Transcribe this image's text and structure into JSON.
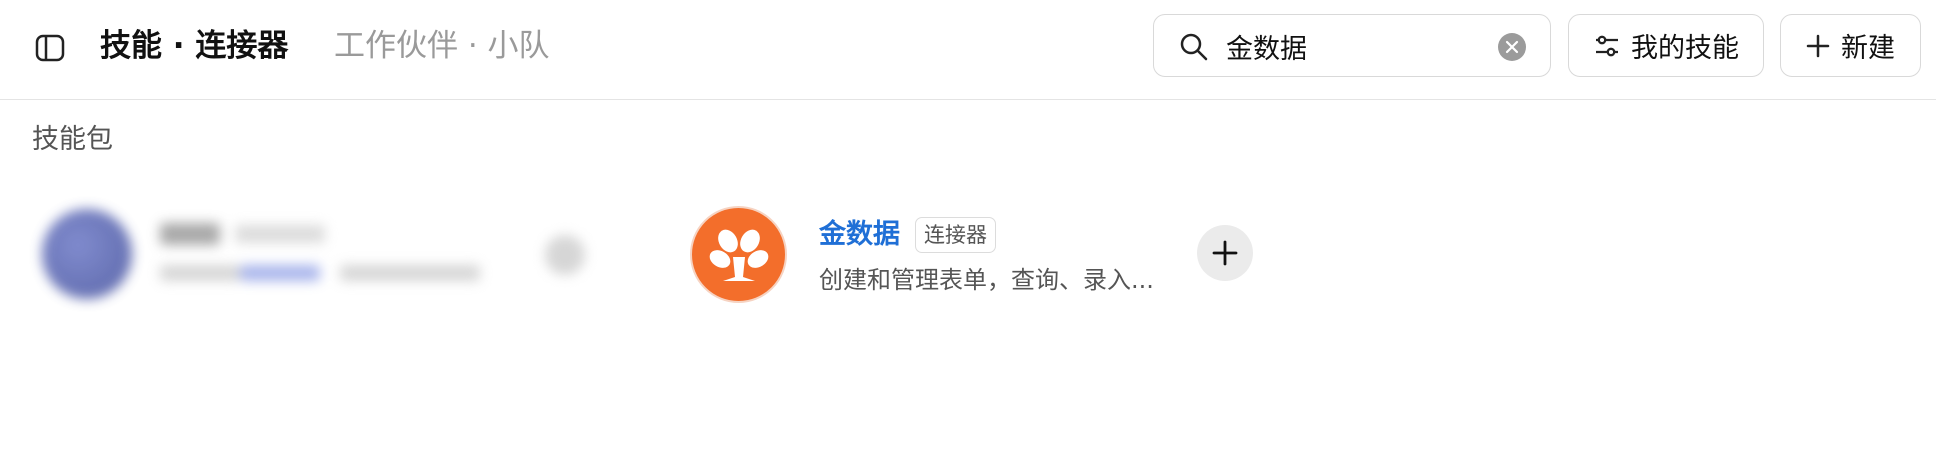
{
  "header": {
    "tabs": [
      {
        "label": "技能 · 连接器",
        "active": true
      },
      {
        "label": "工作伙伴 · 小队",
        "active": false
      }
    ],
    "search": {
      "value": "金数据",
      "placeholder": ""
    },
    "my_skills_label": "我的技能",
    "new_label": "新建"
  },
  "section": {
    "title": "技能包"
  },
  "results": [
    {
      "name": "金数据",
      "badge": "连接器",
      "description": "创建和管理表单，查询、录入...",
      "logo_color": "#f36e2b",
      "icon": "tree-icon"
    }
  ],
  "colors": {
    "accent": "#1f6fd6",
    "logo": "#f36e2b"
  }
}
